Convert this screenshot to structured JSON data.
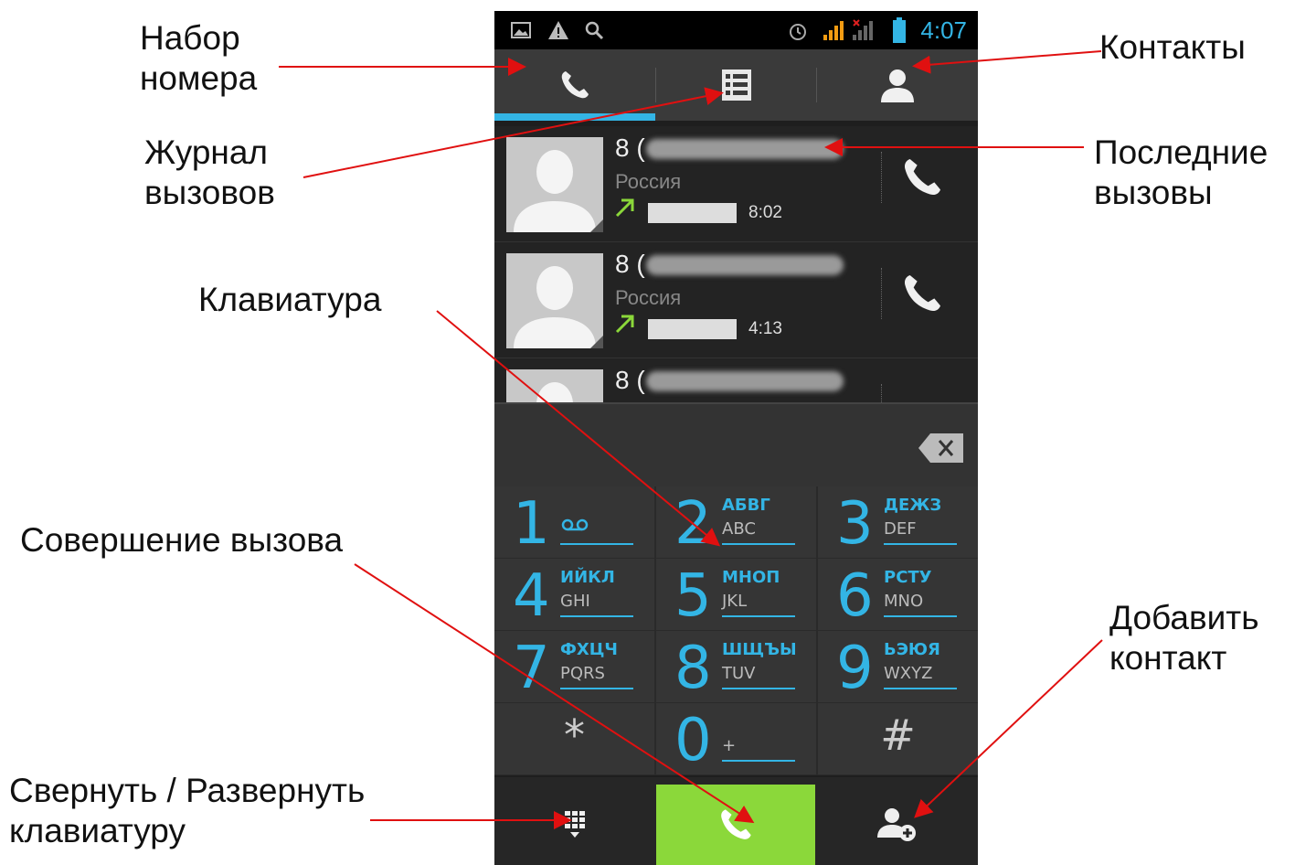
{
  "callouts": {
    "dial_number": "Набор\nномера",
    "contacts": "Контакты",
    "call_log": "Журнал\nвызовов",
    "recent_calls": "Последние\nвызовы",
    "keypad": "Клавиатура",
    "make_call": "Совершение вызова",
    "add_contact": "Добавить\nконтакт",
    "toggle_keypad": "Свернуть / Развернуть\nклавиатуру"
  },
  "status_bar": {
    "time": "4:07",
    "left_icons": [
      "image-icon",
      "warning-icon",
      "search-icon"
    ],
    "right_icons": [
      "alarm-icon",
      "signal-icon",
      "signal-noservice-icon",
      "battery-icon"
    ]
  },
  "tabs": [
    {
      "name": "dialer",
      "icon": "phone-icon",
      "selected": true
    },
    {
      "name": "call-log",
      "icon": "list-icon",
      "selected": false
    },
    {
      "name": "contacts",
      "icon": "person-icon",
      "selected": false
    }
  ],
  "recent_calls": [
    {
      "number_prefix": "8 (",
      "country": "Россия",
      "duration": "8:02"
    },
    {
      "number_prefix": "8 (",
      "country": "Россия",
      "duration": "4:13"
    },
    {
      "number_prefix": "8 (",
      "country": "",
      "duration": ""
    }
  ],
  "keypad": [
    {
      "digit": "1",
      "cyr": "",
      "lat": "",
      "icon": "voicemail-icon"
    },
    {
      "digit": "2",
      "cyr": "АБВГ",
      "lat": "ABC"
    },
    {
      "digit": "3",
      "cyr": "ДЕЖЗ",
      "lat": "DEF"
    },
    {
      "digit": "4",
      "cyr": "ИЙКЛ",
      "lat": "GHI"
    },
    {
      "digit": "5",
      "cyr": "МНОП",
      "lat": "JKL"
    },
    {
      "digit": "6",
      "cyr": "РСТУ",
      "lat": "MNO"
    },
    {
      "digit": "7",
      "cyr": "ФХЦЧ",
      "lat": "PQRS"
    },
    {
      "digit": "8",
      "cyr": "ШЩЪЫ",
      "lat": "TUV"
    },
    {
      "digit": "9",
      "cyr": "ЬЭЮЯ",
      "lat": "WXYZ"
    },
    {
      "digit": "*",
      "cyr": "",
      "lat": ""
    },
    {
      "digit": "0",
      "cyr": "",
      "lat": "+"
    },
    {
      "digit": "#",
      "cyr": "",
      "lat": ""
    }
  ],
  "bottom_bar": {
    "left_icon": "dialpad-toggle-icon",
    "center_icon": "phone-call-icon",
    "right_icon": "add-contact-icon"
  },
  "colors": {
    "accent": "#33b5e5",
    "dial_button": "#8bd83a",
    "annotation_line": "#e01010",
    "outgoing_arrow": "#8bd83a"
  }
}
